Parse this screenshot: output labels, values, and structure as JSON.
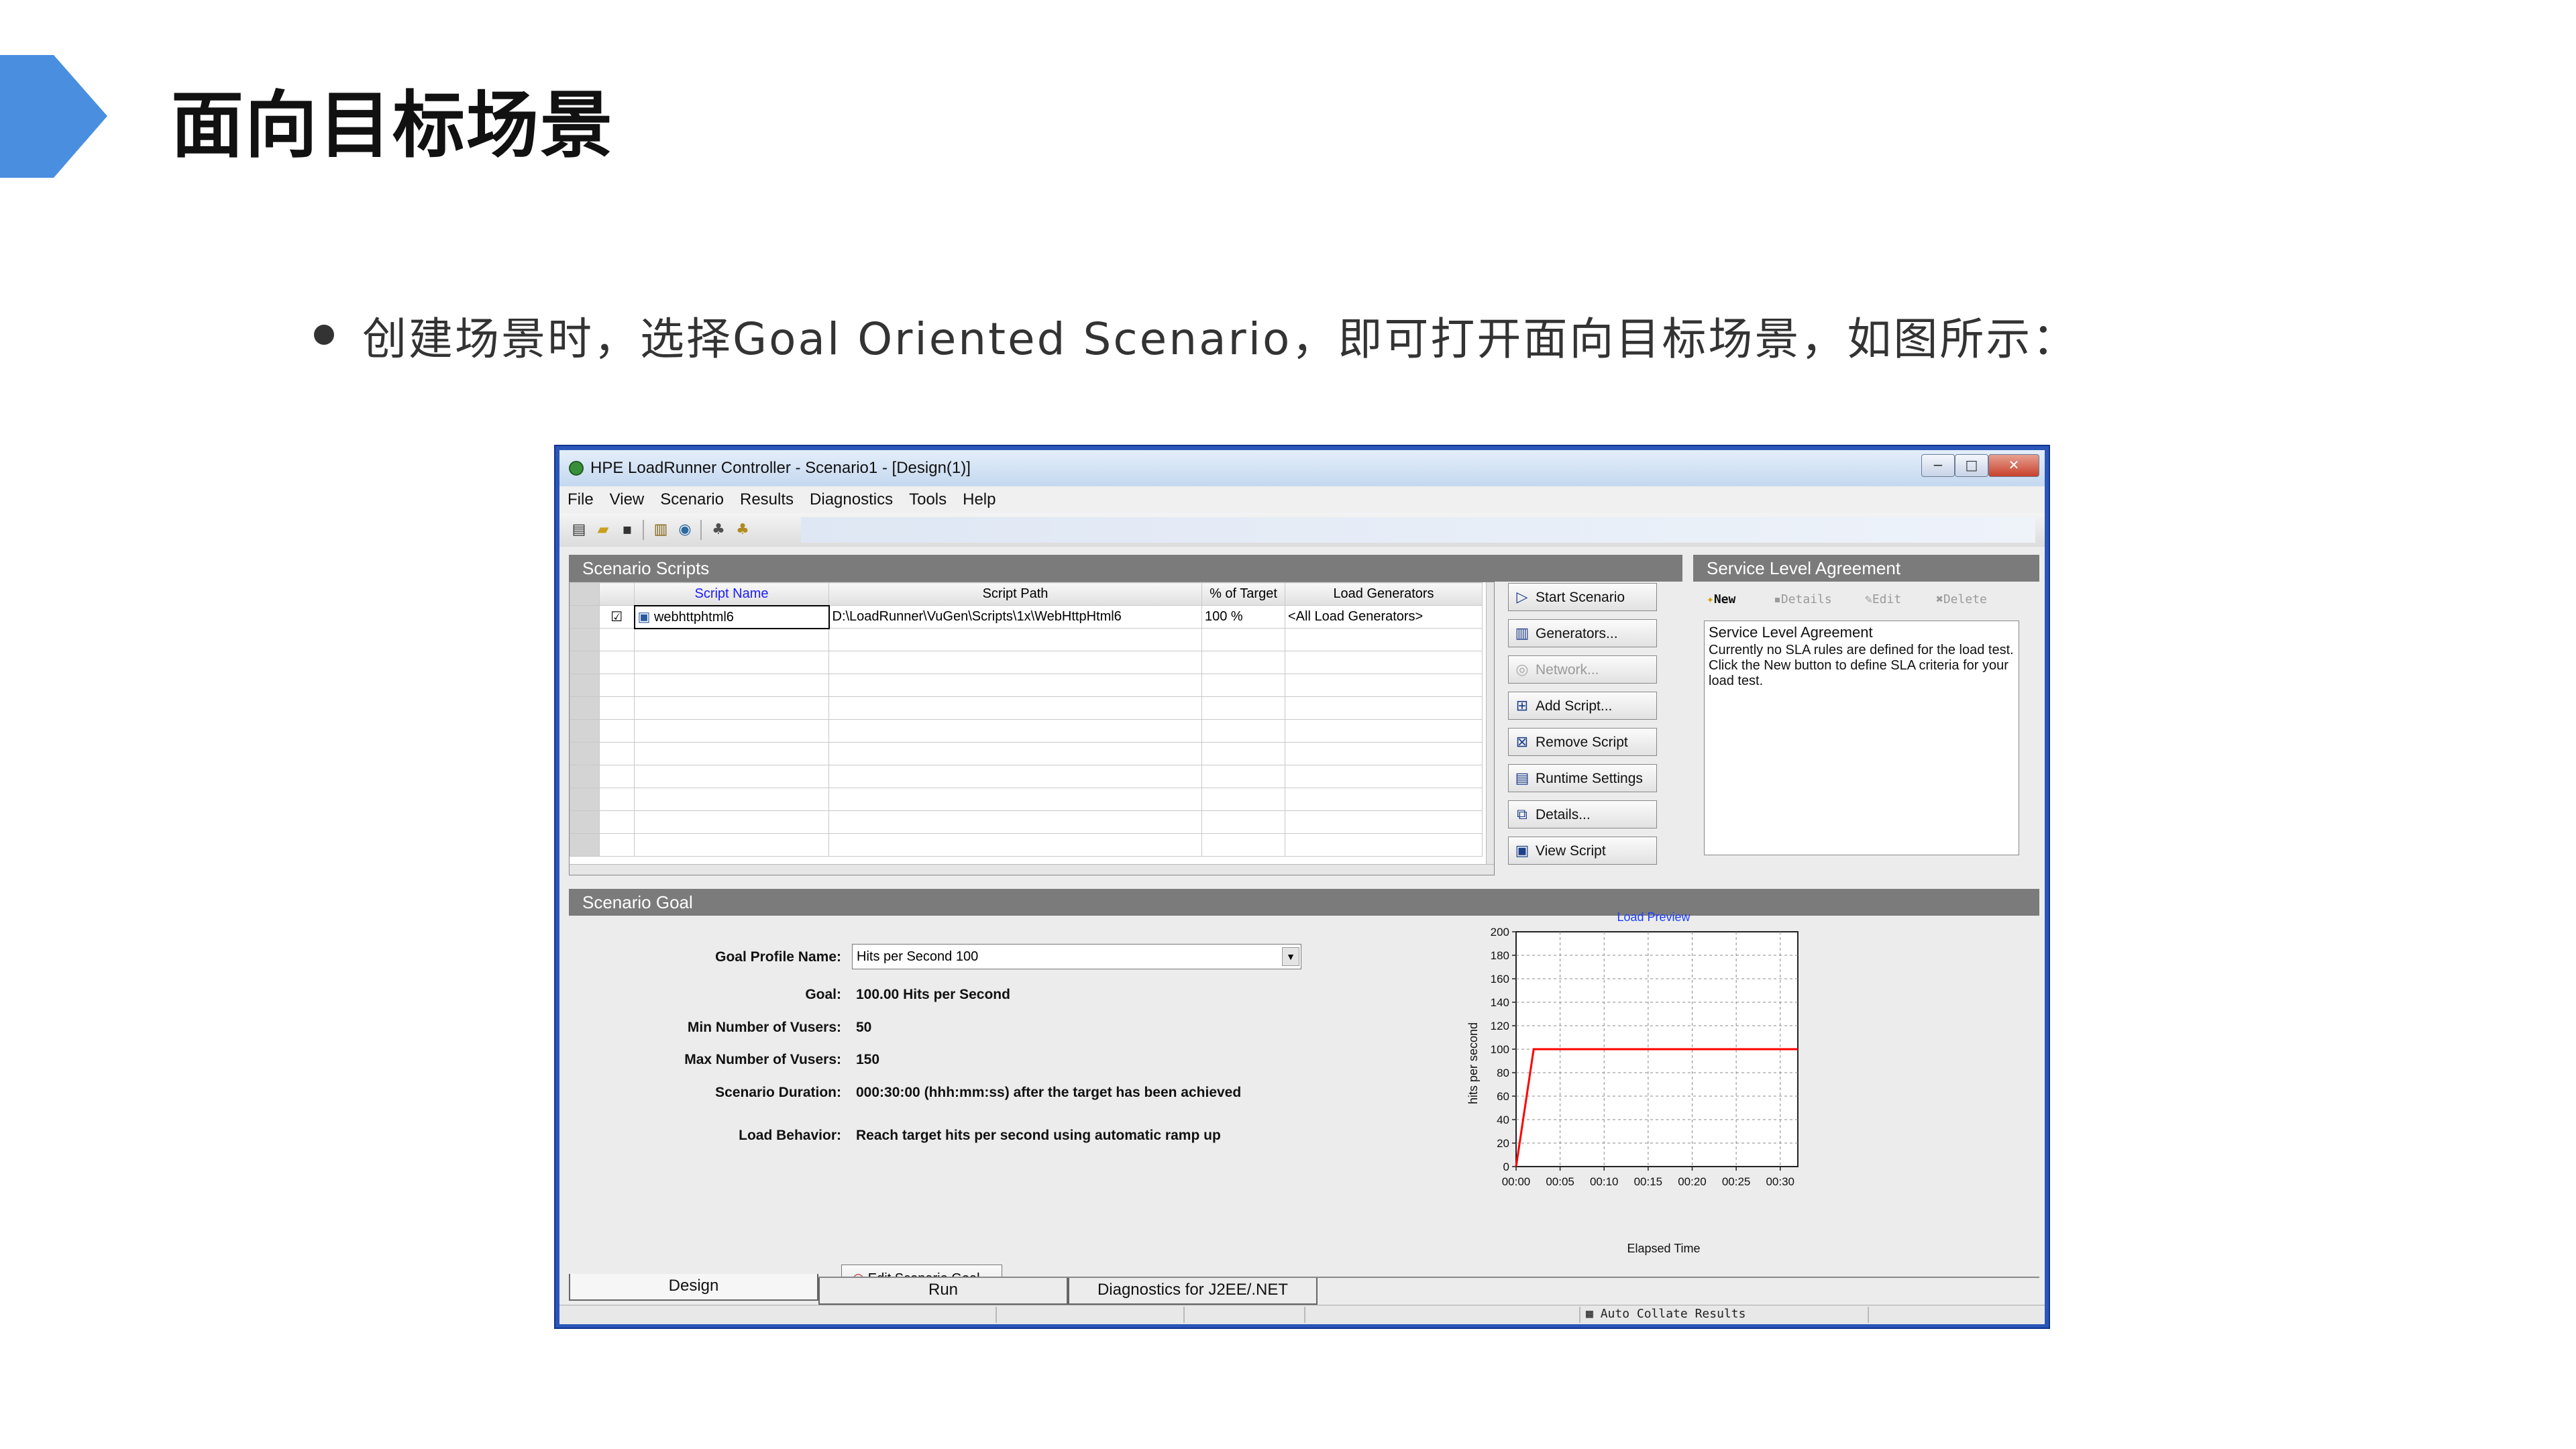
{
  "slide": {
    "title": "面向目标场景",
    "bullet": "创建场景时，选择Goal Oriented Scenario，即可打开面向目标场景，如图所示：",
    "accent_color": "#4a8fdf"
  },
  "window": {
    "title": "HPE LoadRunner Controller - Scenario1 - [Design(1)]",
    "controls": [
      "−",
      "□",
      "✕"
    ]
  },
  "menu": [
    "File",
    "View",
    "Scenario",
    "Results",
    "Diagnostics",
    "Tools",
    "Help"
  ],
  "scripts_panel": {
    "title": "Scenario Scripts",
    "columns": [
      "Script Name",
      "Script Path",
      "% of Target",
      "Load Generators"
    ],
    "rows": [
      {
        "checked": true,
        "name": "webhttphtml6",
        "path": "D:\\LoadRunner\\VuGen\\Scripts\\1x\\WebHttpHtml6",
        "target": "100 %",
        "generators": "<All Load Generators>"
      }
    ]
  },
  "side_buttons": [
    {
      "label": "Start Scenario",
      "icon": "play-icon",
      "glyph": "▷",
      "enabled": true
    },
    {
      "label": "Generators...",
      "icon": "generators-icon",
      "glyph": "▥",
      "enabled": true
    },
    {
      "label": "Network...",
      "icon": "network-icon",
      "glyph": "◎",
      "enabled": false
    },
    {
      "label": "Add Script...",
      "icon": "add-script-icon",
      "glyph": "⊞",
      "enabled": true
    },
    {
      "label": "Remove Script",
      "icon": "remove-script-icon",
      "glyph": "⊠",
      "enabled": true
    },
    {
      "label": "Runtime Settings",
      "icon": "runtime-settings-icon",
      "glyph": "▤",
      "enabled": true
    },
    {
      "label": "Details...",
      "icon": "details-icon",
      "glyph": "⧉",
      "enabled": true
    },
    {
      "label": "View Script",
      "icon": "view-script-icon",
      "glyph": "▣",
      "enabled": true
    }
  ],
  "sla_panel": {
    "title": "Service Level Agreement",
    "toolbar": [
      "New",
      "Details",
      "Edit",
      "Delete"
    ],
    "box_title": "Service Level Agreement",
    "message": "Currently no SLA rules are defined for the load test.",
    "hint": "Click the New button to define SLA criteria for your load test."
  },
  "goal_panel": {
    "title": "Scenario Goal",
    "fields": [
      {
        "label": "Goal Profile Name:",
        "value": "Hits per Second 100"
      },
      {
        "label": "Goal:",
        "value": "100.00 Hits per Second"
      },
      {
        "label": "Min Number of Vusers:",
        "value": "50"
      },
      {
        "label": "Max Number of Vusers:",
        "value": "150"
      },
      {
        "label": "Scenario Duration:",
        "value": "000:30:00 (hhh:mm:ss) after the target has been achieved"
      },
      {
        "label": "Load Behavior:",
        "value": "Reach target hits per second using automatic ramp up"
      }
    ],
    "edit_button": "Edit Scenario Goal..."
  },
  "chart_data": {
    "type": "line",
    "title": "Load Preview",
    "xlabel": "Elapsed Time",
    "ylabel": "hits per second",
    "x_ticks": [
      "00:00",
      "00:05",
      "00:10",
      "00:15",
      "00:20",
      "00:25",
      "00:30"
    ],
    "y_ticks": [
      0,
      20,
      40,
      60,
      80,
      100,
      120,
      140,
      160,
      180,
      200
    ],
    "xlim": [
      0,
      32
    ],
    "ylim": [
      0,
      200
    ],
    "grid": true,
    "series": [
      {
        "color": "#ff0000",
        "points": [
          [
            0,
            0
          ],
          [
            2,
            100
          ],
          [
            32,
            100
          ]
        ]
      }
    ]
  },
  "tabs": [
    "Design",
    "Run",
    "Diagnostics for J2EE/.NET"
  ],
  "status": {
    "auto_collate": "Auto Collate Results"
  }
}
